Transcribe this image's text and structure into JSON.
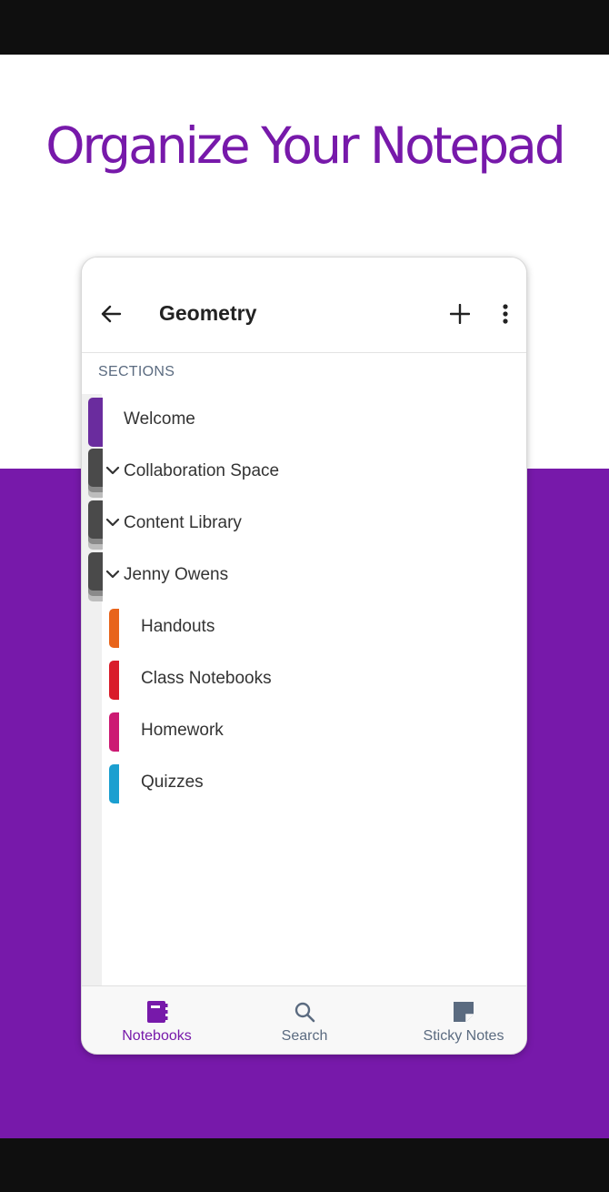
{
  "headline": "Organize Your Notepad",
  "appbar": {
    "title": "Geometry"
  },
  "sections": {
    "header": "SECTIONS",
    "items": [
      {
        "label": "Welcome"
      },
      {
        "label": "Collaboration Space"
      },
      {
        "label": "Content Library"
      },
      {
        "label": "Jenny Owens"
      },
      {
        "label": "Handouts",
        "color": "#e8641b"
      },
      {
        "label": "Class Notebooks",
        "color": "#d91c2a"
      },
      {
        "label": "Homework",
        "color": "#cc1a73"
      },
      {
        "label": "Quizzes",
        "color": "#1b9fd0"
      }
    ]
  },
  "bottom_nav": {
    "items": [
      {
        "label": "Notebooks",
        "icon": "notebook-icon",
        "active": true
      },
      {
        "label": "Search",
        "icon": "search-icon"
      },
      {
        "label": "Sticky Notes",
        "icon": "sticky-note-icon"
      }
    ]
  },
  "colors": {
    "brand_purple": "#7719aa",
    "group_tab": "#4a4a4a",
    "welcome_tab": "#6a2c9e"
  }
}
